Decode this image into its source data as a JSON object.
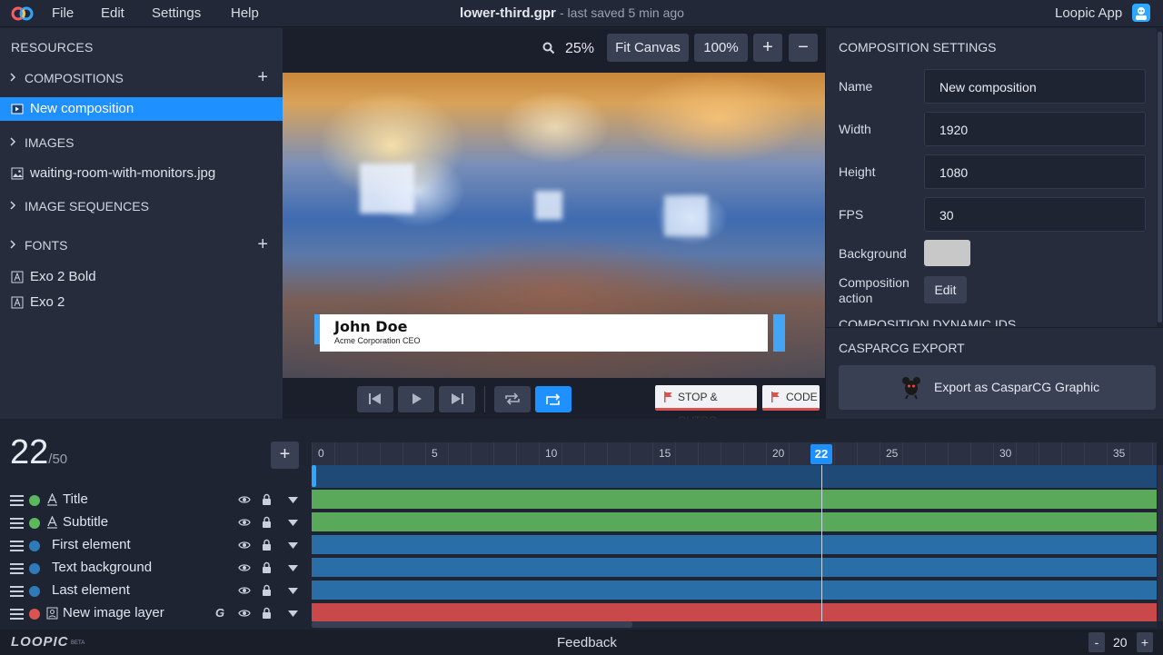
{
  "menubar": {
    "file": "File",
    "edit": "Edit",
    "settings": "Settings",
    "help": "Help",
    "filename": "lower-third.gpr",
    "saved_status": "- last saved 5 min ago",
    "app_name": "Loopic App"
  },
  "resources": {
    "title": "RESOURCES",
    "compositions": {
      "label": "COMPOSITIONS",
      "items": [
        "New composition"
      ]
    },
    "images": {
      "label": "IMAGES",
      "items": [
        "waiting-room-with-monitors.jpg"
      ]
    },
    "image_sequences": {
      "label": "IMAGE SEQUENCES"
    },
    "fonts": {
      "label": "FONTS",
      "items": [
        "Exo 2 Bold",
        "Exo 2"
      ]
    }
  },
  "canvas": {
    "zoom_value": "25%",
    "fit_canvas": "Fit Canvas",
    "zoom_100": "100%",
    "zoom_in": "+",
    "zoom_out": "−",
    "lower_third": {
      "name": "John Doe",
      "subtitle": "Acme Corporation CEO"
    }
  },
  "transport": {
    "stop_outro": "STOP & OUTRO",
    "code": "CODE"
  },
  "settings": {
    "title": "COMPOSITION SETTINGS",
    "name_label": "Name",
    "name_value": "New composition",
    "width_label": "Width",
    "width_value": "1920",
    "height_label": "Height",
    "height_value": "1080",
    "fps_label": "FPS",
    "fps_value": "30",
    "background_label": "Background",
    "background_color": "#c8c8c8",
    "action_label": "Composition action",
    "action_button": "Edit",
    "dynamic_ids_label": "COMPOSITION DYNAMIC IDS",
    "export_title": "CASPARCG EXPORT",
    "export_button": "Export as CasparCG Graphic"
  },
  "timeline": {
    "current_frame": "22",
    "total_frames": "/50",
    "add_button": "+",
    "ruler_ticks": [
      "0",
      "5",
      "10",
      "15",
      "20",
      "25",
      "30",
      "35"
    ],
    "playhead_label": "22",
    "layers": [
      {
        "name": "Title",
        "type": "text",
        "color": "#5cb85c"
      },
      {
        "name": "Subtitle",
        "type": "text",
        "color": "#5cb85c"
      },
      {
        "name": "First element",
        "type": "shape",
        "color": "#2f7ab8"
      },
      {
        "name": "Text background",
        "type": "shape",
        "color": "#2f7ab8"
      },
      {
        "name": "Last element",
        "type": "shape",
        "color": "#2f7ab8"
      },
      {
        "name": "New image layer",
        "type": "image",
        "color": "#d9534f",
        "guide": "G"
      }
    ]
  },
  "statusbar": {
    "logo": "LOOPIC",
    "beta": "BETA",
    "feedback": "Feedback",
    "zoom_minus": "-",
    "zoom_value": "20",
    "zoom_plus": "+"
  },
  "colors": {
    "accent": "#1e90ff",
    "panel": "#272c3d",
    "background": "#1f2433",
    "green_track": "#5aa95a",
    "blue_track": "#2a6ea8",
    "red_track": "#c9484a"
  }
}
